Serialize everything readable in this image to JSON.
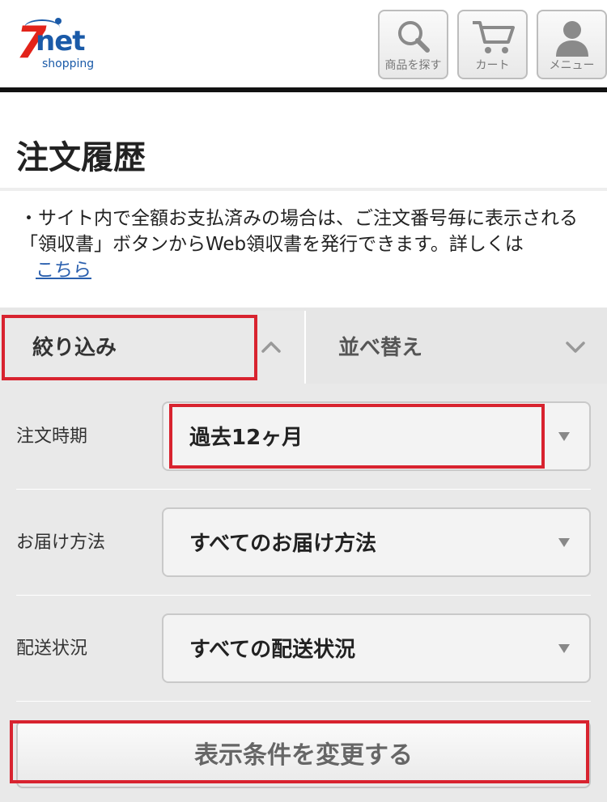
{
  "header": {
    "logo": {
      "seven": "7",
      "net": "net",
      "sub": "shopping"
    },
    "search_label": "商品を探す",
    "cart_label": "カート",
    "menu_label": "メニュー"
  },
  "page": {
    "title": "注文履歴",
    "info_text": "・サイト内で全額お支払済みの場合は、ご注文番号毎に表示される「領収書」ボタンからWeb領収書を発行できます。詳しくは",
    "info_link": "こちら"
  },
  "tabs": {
    "filter_label": "絞り込み",
    "sort_label": "並べ替え"
  },
  "filters": [
    {
      "label": "注文時期",
      "value": "過去12ヶ月"
    },
    {
      "label": "お届け方法",
      "value": "すべてのお届け方法"
    },
    {
      "label": "配送状況",
      "value": "すべての配送状況"
    }
  ],
  "apply_label": "表示条件を変更する",
  "colors": {
    "brand_red": "#e2231a",
    "brand_blue": "#1a5aa8",
    "highlight": "#d8232f",
    "link": "#2a5fae"
  }
}
